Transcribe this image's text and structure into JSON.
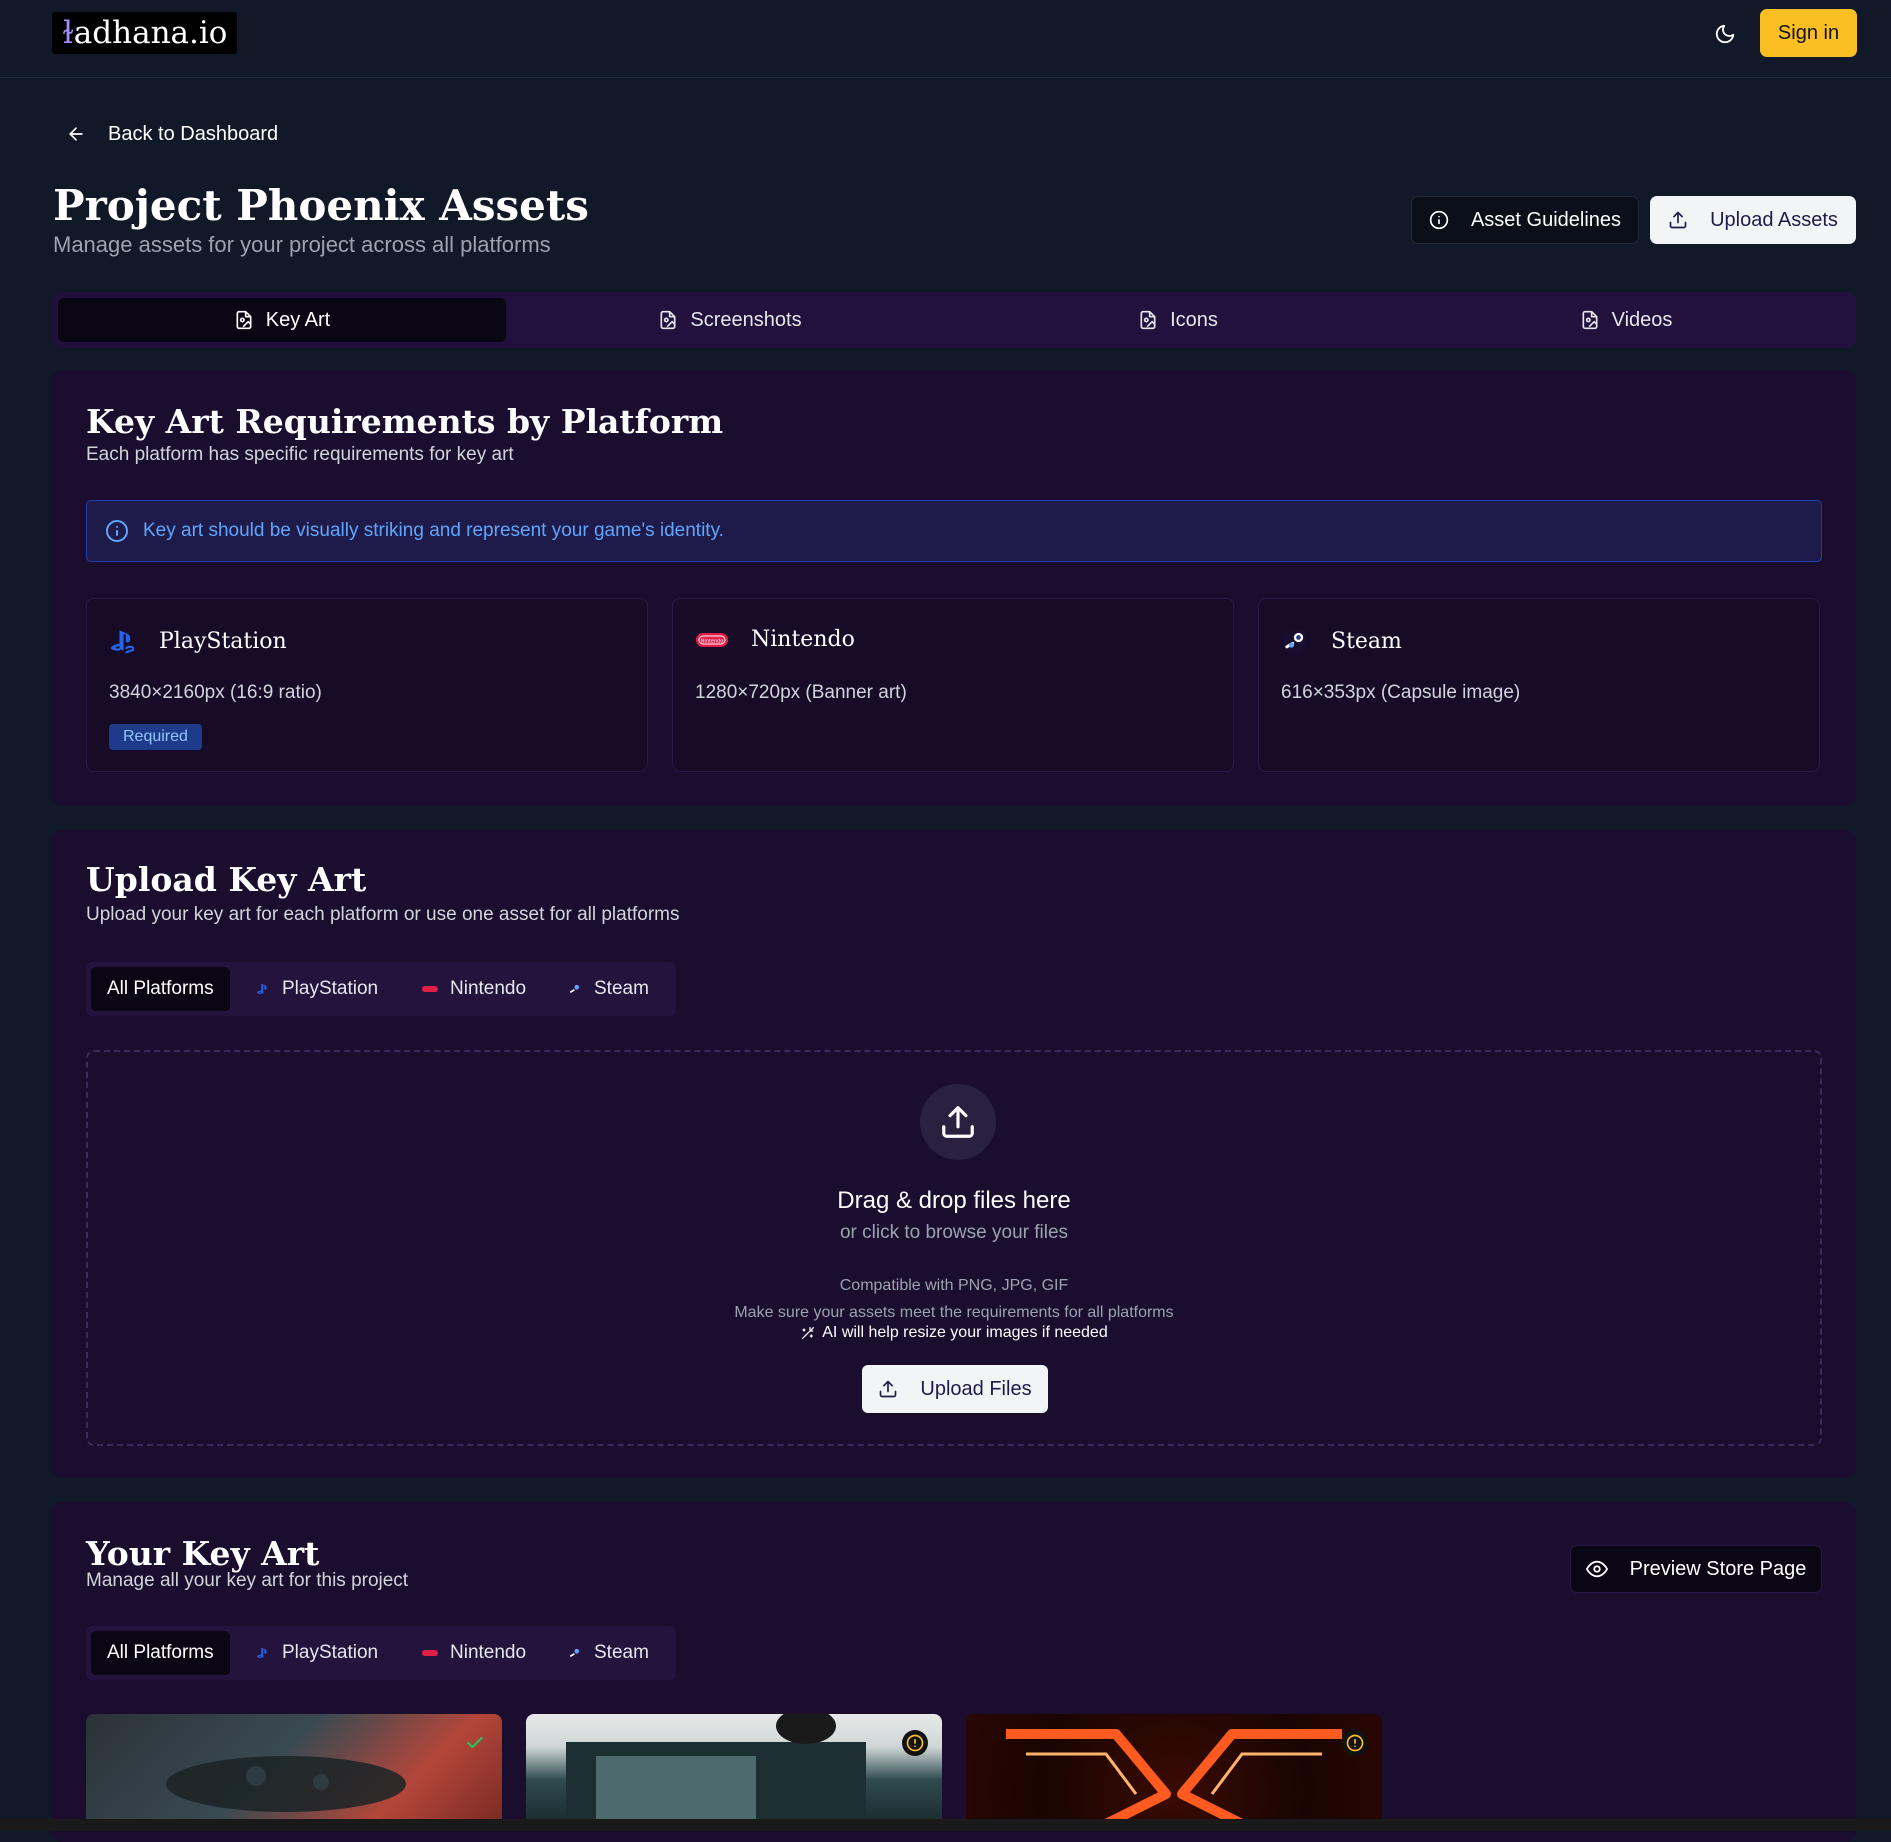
{
  "header": {
    "logo_mark": "ɫ",
    "logo_text": "adhana.io",
    "signin_label": "Sign in",
    "theme_icon": "moon-icon"
  },
  "nav": {
    "back_label": "Back to Dashboard"
  },
  "page": {
    "title": "Project Phoenix Assets",
    "subtitle": "Manage assets for your project across all platforms",
    "guidelines_label": "Asset Guidelines",
    "upload_label": "Upload Assets"
  },
  "tabs": [
    {
      "label": "Key Art",
      "active": true
    },
    {
      "label": "Screenshots",
      "active": false
    },
    {
      "label": "Icons",
      "active": false
    },
    {
      "label": "Videos",
      "active": false
    }
  ],
  "requirements": {
    "title": "Key Art Requirements by Platform",
    "subtitle": "Each platform has specific requirements for key art",
    "info": "Key art should be visually striking and represent your game's identity.",
    "platforms": [
      {
        "name": "PlayStation",
        "spec": "3840×2160px (16:9 ratio)",
        "badge": "Required",
        "icon": "playstation-icon"
      },
      {
        "name": "Nintendo",
        "spec": "1280×720px (Banner art)",
        "icon": "nintendo-icon"
      },
      {
        "name": "Steam",
        "spec": "616×353px (Capsule image)",
        "icon": "steam-icon"
      }
    ]
  },
  "upload": {
    "title": "Upload Key Art",
    "subtitle": "Upload your key art for each platform or use one asset for all platforms",
    "filters": [
      "All Platforms",
      "PlayStation",
      "Nintendo",
      "Steam"
    ],
    "drop_title": "Drag & drop files here",
    "drop_sub": "or click to browse your files",
    "compat": "Compatible with PNG, JPG, GIF",
    "requirements_note": "Make sure your assets meet the requirements for all platforms",
    "ai_note": "AI will help resize your images if needed",
    "button_label": "Upload Files"
  },
  "library": {
    "title": "Your Key Art",
    "subtitle": "Manage all your key art for this project",
    "preview_label": "Preview Store Page",
    "filters": [
      "All Platforms",
      "PlayStation",
      "Nintendo",
      "Steam"
    ],
    "items": [
      {
        "status": "approved",
        "status_icon": "check-icon"
      },
      {
        "status": "warning",
        "status_icon": "alert-icon"
      },
      {
        "status": "warning",
        "status_icon": "alert-icon"
      }
    ]
  },
  "colors": {
    "accent": "#fbbf24",
    "background": "#111827",
    "card": "#1a0d2e",
    "info": "#60a5fa",
    "playstation": "#2563eb",
    "nintendo": "#e11d48"
  }
}
